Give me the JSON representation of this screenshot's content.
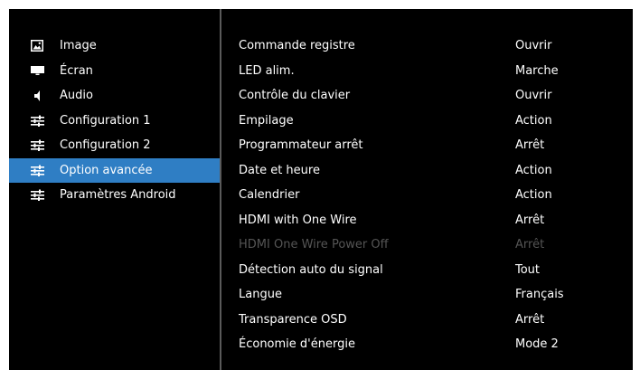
{
  "sidebar": {
    "items": [
      {
        "label": "Image",
        "icon": "image-icon",
        "active": false
      },
      {
        "label": "Écran",
        "icon": "screen-icon",
        "active": false
      },
      {
        "label": "Audio",
        "icon": "speaker-icon",
        "active": false
      },
      {
        "label": "Configuration 1",
        "icon": "sliders-icon",
        "active": false
      },
      {
        "label": "Configuration 2",
        "icon": "sliders-icon",
        "active": false
      },
      {
        "label": "Option avancée",
        "icon": "sliders-icon",
        "active": true
      },
      {
        "label": "Paramètres Android",
        "icon": "sliders-icon",
        "active": false
      }
    ]
  },
  "settings": {
    "rows": [
      {
        "label": "Commande registre",
        "value": "Ouvrir",
        "disabled": false
      },
      {
        "label": "LED alim.",
        "value": "Marche",
        "disabled": false
      },
      {
        "label": "Contrôle du clavier",
        "value": "Ouvrir",
        "disabled": false
      },
      {
        "label": "Empilage",
        "value": "Action",
        "disabled": false
      },
      {
        "label": "Programmateur arrêt",
        "value": "Arrêt",
        "disabled": false
      },
      {
        "label": "Date et heure",
        "value": "Action",
        "disabled": false
      },
      {
        "label": "Calendrier",
        "value": "Action",
        "disabled": false
      },
      {
        "label": "HDMI with One Wire",
        "value": "Arrêt",
        "disabled": false
      },
      {
        "label": "HDMI One Wire Power Off",
        "value": "Arrêt",
        "disabled": true
      },
      {
        "label": "Détection auto du signal",
        "value": "Tout",
        "disabled": false
      },
      {
        "label": "Langue",
        "value": "Français",
        "disabled": false
      },
      {
        "label": "Transparence OSD",
        "value": "Arrêt",
        "disabled": false
      },
      {
        "label": "Économie d'énergie",
        "value": "Mode 2",
        "disabled": false
      }
    ]
  },
  "colors": {
    "background": "#000000",
    "highlight": "#2f7ec4",
    "text": "#ffffff",
    "disabled_text": "#555555",
    "divider": "#5a5a5a"
  }
}
